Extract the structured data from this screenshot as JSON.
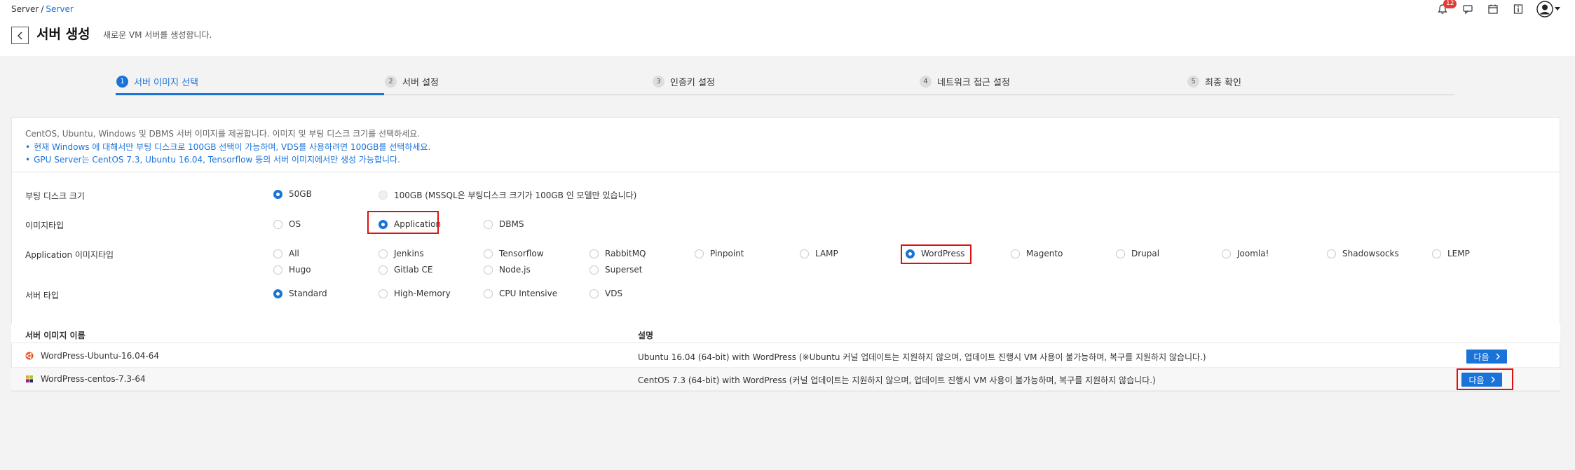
{
  "header": {
    "breadcrumb_root": "Server",
    "breadcrumb_sep": "/",
    "breadcrumb_current": "Server",
    "title": "서버 생성",
    "subtitle": "새로운 VM 서버를 생성합니다.",
    "notification_count": "12"
  },
  "steps": [
    {
      "num": "1",
      "label": "서버 이미지 선택"
    },
    {
      "num": "2",
      "label": "서버 설정"
    },
    {
      "num": "3",
      "label": "인증키 설정"
    },
    {
      "num": "4",
      "label": "네트워크 접근 설정"
    },
    {
      "num": "5",
      "label": "최종 확인"
    }
  ],
  "info": {
    "line1": "CentOS, Ubuntu, Windows 및 DBMS 서버 이미지를 제공합니다. 이미지 및 부팅 디스크 크기를 선택하세요.",
    "bullet1": "현재 Windows 에 대해서만 부팅 디스크로 100GB 선택이 가능하며, VDS를 사용하려면 100GB를 선택하세요.",
    "bullet2": "GPU Server는 CentOS 7.3, Ubuntu 16.04, Tensorflow 등의 서버 이미지에서만 생성 가능합니다."
  },
  "form": {
    "boot_disk": {
      "label": "부팅 디스크 크기",
      "opt1": "50GB",
      "opt2": "100GB (MSSQL은 부팅디스크 크기가 100GB 인 모델만 있습니다)"
    },
    "image_type": {
      "label": "이미지타입",
      "opt1": "OS",
      "opt2": "Application",
      "opt3": "DBMS"
    },
    "app_image_type": {
      "label": "Application 이미지타입",
      "options": [
        "All",
        "Jenkins",
        "Tensorflow",
        "RabbitMQ",
        "Pinpoint",
        "LAMP",
        "WordPress",
        "Magento",
        "Drupal",
        "Joomla!",
        "Shadowsocks",
        "LEMP",
        "Hugo",
        "Gitlab CE",
        "Node.js",
        "Superset"
      ]
    },
    "server_type": {
      "label": "서버 타입",
      "opt1": "Standard",
      "opt2": "High-Memory",
      "opt3": "CPU Intensive",
      "opt4": "VDS"
    }
  },
  "table": {
    "col_name": "서버 이미지 이름",
    "col_desc": "설명",
    "rows": [
      {
        "name": "WordPress-Ubuntu-16.04-64",
        "desc": "Ubuntu 16.04 (64-bit) with WordPress (※Ubuntu 커널 업데이트는 지원하지 않으며, 업데이트 진행시 VM 사용이 불가능하며, 복구를 지원하지 않습니다.)",
        "button": "다음"
      },
      {
        "name": "WordPress-centos-7.3-64",
        "desc": "CentOS 7.3 (64-bit) with WordPress (커널 업데이트는 지원하지 않으며, 업데이트 진행시 VM 사용이 불가능하며, 복구를 지원하지 않습니다.)",
        "button": "다음"
      }
    ]
  },
  "colors": {
    "accent": "#1a73d9",
    "highlight": "#e01010"
  }
}
